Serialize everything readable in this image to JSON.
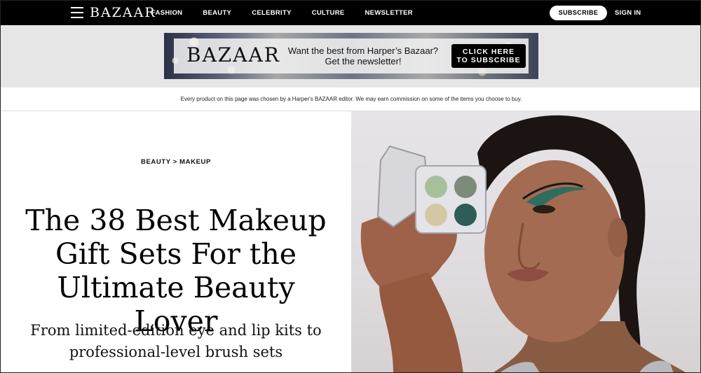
{
  "header": {
    "logo": "BAZAAR",
    "nav": [
      "FASHION",
      "BEAUTY",
      "CELEBRITY",
      "CULTURE",
      "NEWSLETTER"
    ],
    "subscribe_label": "SUBSCRIBE",
    "signin_label": "SIGN IN"
  },
  "ad": {
    "logo": "BAZAAR",
    "line1": "Want the best from Harper’s Bazaar?",
    "line2": "Get the newsletter!",
    "cta_line1": "CLICK HERE",
    "cta_line2": "TO SUBSCRIBE"
  },
  "disclaimer": "Every product on this page was chosen by a Harper's BAZAAR editor. We may earn commission on some of the items you choose to buy.",
  "article": {
    "breadcrumb_section": "BEAUTY",
    "breadcrumb_sep": " > ",
    "breadcrumb_sub": "MAKEUP",
    "headline": "The 38 Best Makeup Gift Sets For the Ultimate Beauty Lover",
    "dek": "From limited-edition eye and lip kits to professional-level brush sets"
  },
  "colors": {
    "nav_bg": "#000000",
    "ad_strip_bg": "#e6e6e6",
    "cta_bg": "#000000"
  },
  "icons": {
    "menu": "hamburger-icon"
  }
}
